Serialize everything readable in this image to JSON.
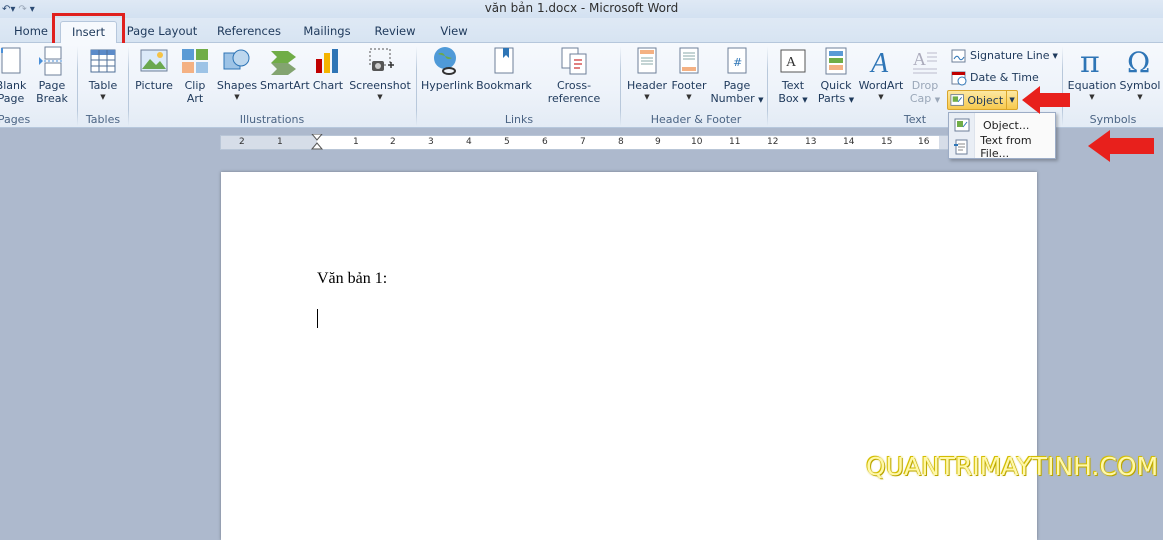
{
  "window": {
    "title": "văn bản 1.docx  -  Microsoft Word"
  },
  "tabs": [
    "Home",
    "Insert",
    "Page Layout",
    "References",
    "Mailings",
    "Review",
    "View"
  ],
  "active_tab": "Insert",
  "ribbon": {
    "pages": {
      "blank_page": [
        "Blank",
        "Page"
      ],
      "page_break": [
        "Page",
        "Break"
      ],
      "group": "Pages"
    },
    "tables": {
      "table": "Table",
      "group": "Tables"
    },
    "illustrations": {
      "picture": "Picture",
      "clip_art": [
        "Clip",
        "Art"
      ],
      "shapes": "Shapes",
      "smartart": "SmartArt",
      "chart": "Chart",
      "screenshot": "Screenshot",
      "group": "Illustrations"
    },
    "links": {
      "hyperlink": "Hyperlink",
      "bookmark": "Bookmark",
      "cross_reference": "Cross-reference",
      "group": "Links"
    },
    "header_footer": {
      "header": "Header",
      "footer": "Footer",
      "page_number": [
        "Page",
        "Number"
      ],
      "group": "Header & Footer"
    },
    "text": {
      "text_box": [
        "Text",
        "Box"
      ],
      "quick_parts": [
        "Quick",
        "Parts"
      ],
      "wordart": "WordArt",
      "drop_cap": [
        "Drop",
        "Cap"
      ],
      "signature_line": "Signature Line",
      "date_time": "Date & Time",
      "object": "Object",
      "group": "Text"
    },
    "symbols": {
      "equation": "Equation",
      "symbol": "Symbol",
      "group": "Symbols"
    }
  },
  "object_menu": {
    "items": [
      "Object...",
      "Text from File..."
    ]
  },
  "ruler": {
    "labels": [
      "2",
      "1",
      "1",
      "2",
      "3",
      "4",
      "5",
      "6",
      "7",
      "8",
      "9",
      "10",
      "11",
      "12",
      "13",
      "14",
      "15",
      "16"
    ]
  },
  "document": {
    "line1": "Văn bản 1:"
  },
  "watermark": "QUANTRIMAYTINH.COM",
  "colors": {
    "highlight_box": "#e0201e",
    "arrow": "#e8201c",
    "object_highlight": "#f7c94e"
  }
}
